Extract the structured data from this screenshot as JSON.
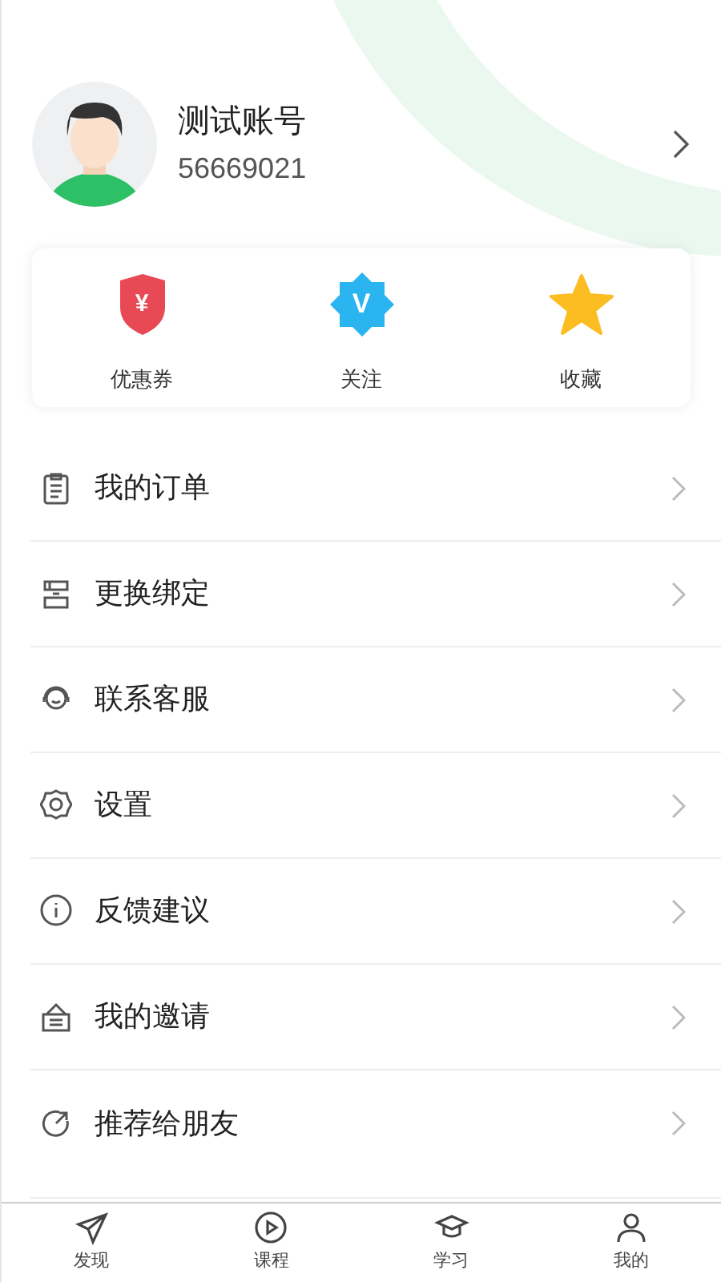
{
  "profile": {
    "name": "测试账号",
    "account_id": "56669021"
  },
  "shortcuts": [
    {
      "kind": "coupon",
      "icon_text": "¥",
      "label": "优惠券"
    },
    {
      "kind": "follow",
      "icon_text": "V",
      "label": "关注"
    },
    {
      "kind": "favorite",
      "label": "收藏"
    }
  ],
  "menu": [
    {
      "kind": "orders",
      "label": "我的订单"
    },
    {
      "kind": "binding",
      "label": "更换绑定"
    },
    {
      "kind": "service",
      "label": "联系客服"
    },
    {
      "kind": "settings",
      "label": "设置"
    },
    {
      "kind": "feedback",
      "label": "反馈建议"
    },
    {
      "kind": "invite",
      "label": "我的邀请"
    },
    {
      "kind": "share",
      "label": "推荐给朋友"
    }
  ],
  "tab_bar": [
    {
      "kind": "discover",
      "label": "发现"
    },
    {
      "kind": "courses",
      "label": "课程"
    },
    {
      "kind": "study",
      "label": "学习"
    },
    {
      "kind": "me",
      "label": "我的"
    }
  ]
}
